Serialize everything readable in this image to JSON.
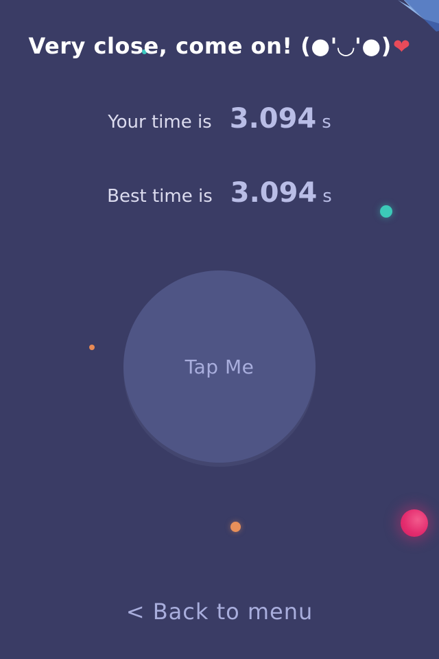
{
  "game": {
    "headline": "Very close, come on! (●'◡'●)",
    "heart_icon": "heart-icon",
    "your_time": {
      "label": "Your time is",
      "value": "3.094",
      "unit": "s"
    },
    "best_time": {
      "label": "Best time is",
      "value": "3.094",
      "unit": "s"
    },
    "tap_button_label": "Tap Me",
    "back_link": "< Back to menu"
  },
  "colors": {
    "background": "#3a3c65",
    "button": "#4f5585",
    "accent_text": "#a9aedd",
    "heart": "#e84b5a",
    "teal": "#3cc9b8",
    "orange": "#e8905a",
    "pink": "#e42d6f"
  }
}
